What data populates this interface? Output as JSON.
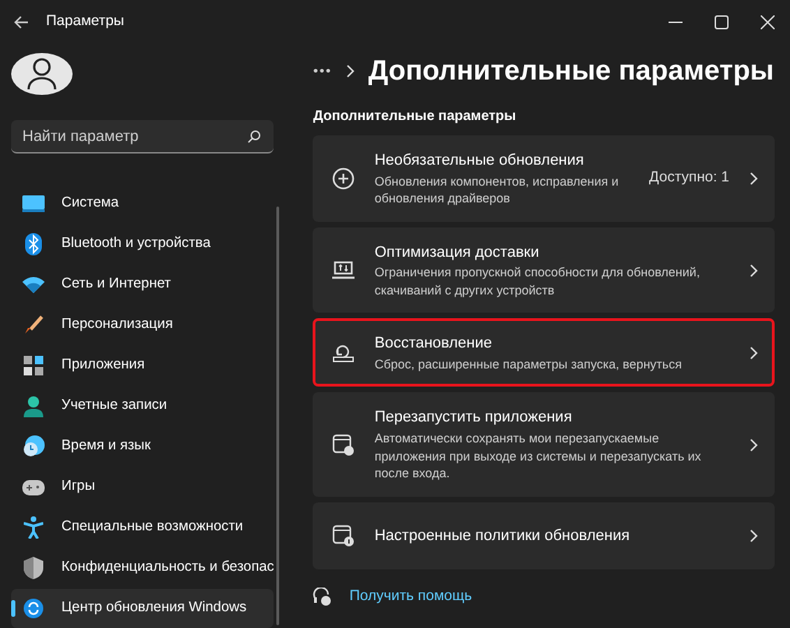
{
  "window": {
    "title": "Параметры"
  },
  "sidebar": {
    "search": {
      "placeholder": "Найти параметр"
    },
    "items": [
      {
        "label": "Система",
        "selected": false
      },
      {
        "label": "Bluetooth и устройства",
        "selected": false
      },
      {
        "label": "Сеть и Интернет",
        "selected": false
      },
      {
        "label": "Персонализация",
        "selected": false
      },
      {
        "label": "Приложения",
        "selected": false
      },
      {
        "label": "Учетные записи",
        "selected": false
      },
      {
        "label": "Время и язык",
        "selected": false
      },
      {
        "label": "Игры",
        "selected": false
      },
      {
        "label": "Специальные возможности",
        "selected": false
      },
      {
        "label": "Конфиденциальность и безопас",
        "selected": false
      },
      {
        "label": "Центр обновления Windows",
        "selected": true
      }
    ]
  },
  "breadcrumb": {
    "ellipsis": "•••",
    "title": "Дополнительные параметры"
  },
  "section_label": "Дополнительные параметры",
  "cards": [
    {
      "title": "Необязательные обновления",
      "description": "Обновления компонентов, исправления и обновления драйверов",
      "value": "Доступно: 1",
      "highlighted": false
    },
    {
      "title": "Оптимизация доставки",
      "description": "Ограничения пропускной способности для обновлений, скачиваний с других устройств",
      "highlighted": false
    },
    {
      "title": "Восстановление",
      "description": "Сброс, расширенные параметры запуска, вернуться",
      "highlighted": true
    },
    {
      "title": "Перезапустить приложения",
      "description": "Автоматически сохранять мои перезапускаемые приложения при выходе из системы и перезапускать их после входа.",
      "highlighted": false
    },
    {
      "title": "Настроенные политики обновления",
      "highlighted": false
    }
  ],
  "help_link": "Получить помощь"
}
